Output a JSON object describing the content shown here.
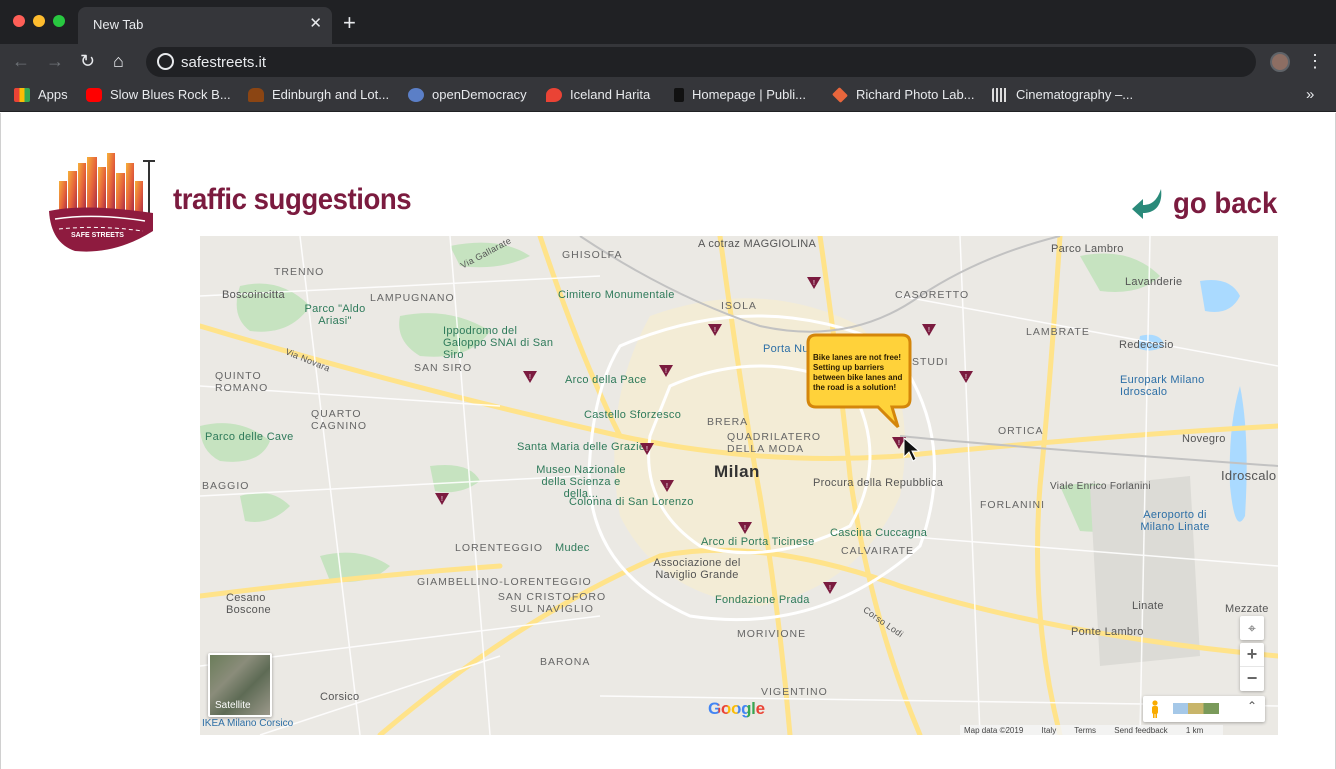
{
  "browser": {
    "tab_title": "New Tab",
    "tab_close": "✕",
    "new_tab": "+",
    "url": "safestreets.it",
    "bookmarks": [
      {
        "label": "Apps",
        "color": "#ea4335"
      },
      {
        "label": "Slow Blues Rock B...",
        "color": "#ff0000"
      },
      {
        "label": "Edinburgh and Lot...",
        "color": "#8b4513"
      },
      {
        "label": "openDemocracy",
        "color": "#5b7fc7"
      },
      {
        "label": "Iceland Harita",
        "color": "#ea4335"
      },
      {
        "label": "Homepage | Publi...",
        "color": "#111111"
      },
      {
        "label": "Richard Photo Lab...",
        "color": "#e8663c"
      },
      {
        "label": "Cinematography –...",
        "color": "#dddddd"
      }
    ],
    "bookmarks_more": "»"
  },
  "page": {
    "title": "traffic suggestions",
    "go_back_label": "go back",
    "logo_text": "SAFE STREETS"
  },
  "map": {
    "city_label": "Milan",
    "places": [
      "GHISOLFA",
      "A cotraz MAGGIOLINA",
      "Parco Lambro",
      "TRENNO",
      "LAMPUGNANO",
      "Boscoincitta",
      "Parco \"Aldo Ariasi\"",
      "Cimitero Monumentale",
      "ISOLA",
      "CASORETTO",
      "Lavanderie",
      "Ippodromo del Galoppo SNAI di San Siro",
      "Porta Nuova",
      "LAMBRATE",
      "Redecesio",
      "QUINTO ROMANO",
      "SAN SIRO",
      "Arco della Pace",
      "STUDI",
      "Europark Milano Idroscalo",
      "Castello Sforzesco",
      "QUARTO CAGNINO",
      "BRERA",
      "QUADRILATERO DELLA MODA",
      "ORTICA",
      "Novegro",
      "Parco delle Cave",
      "Santa Maria delle Grazie",
      "Idroscalo",
      "Museo Nazionale della Scienza e della...",
      "Procura della Repubblica",
      "BAGGIO",
      "Viale Enrico Forlanini",
      "Colonna di San Lorenzo",
      "FORLANINI",
      "LORENTEGGIO",
      "Mudec",
      "Arco di Porta Ticinese",
      "Cascina Cuccagna",
      "CALVAIRATE",
      "Aeroporto di Milano Linate",
      "Associazione del Naviglio Grande",
      "Cesano Boscone",
      "GIAMBELLINO-LORENTEGGIO",
      "SAN CRISTOFORO SUL NAVIGLIO",
      "Fondazione Prada",
      "Linate",
      "Mezzate",
      "MORIVIONE",
      "Ponte Lambro",
      "BARONA",
      "VIGENTINO",
      "Corsico",
      "IKEA Milano Corsico",
      "Via Novara",
      "Via Gallarate",
      "Corso Lodi"
    ],
    "suggestion_text": "Bike lanes are not free! Setting up barriers between bike lanes and the road is a solution!",
    "marker_symbol": "!",
    "satellite_label": "Satellite",
    "locate_icon": "⌖",
    "zoom_in": "+",
    "zoom_out": "−",
    "expand_icon": "⌃",
    "google_logo": "Google",
    "attribution": [
      "Map data ©2019",
      "Italy",
      "Terms",
      "Send feedback",
      "1 km"
    ]
  },
  "colors": {
    "brand": "#7b1b3f",
    "marker": "#7b1b3f",
    "back_arrow": "#2a8a7a",
    "bubble_fill": "#ffd23a",
    "bubble_border": "#d4860b"
  }
}
